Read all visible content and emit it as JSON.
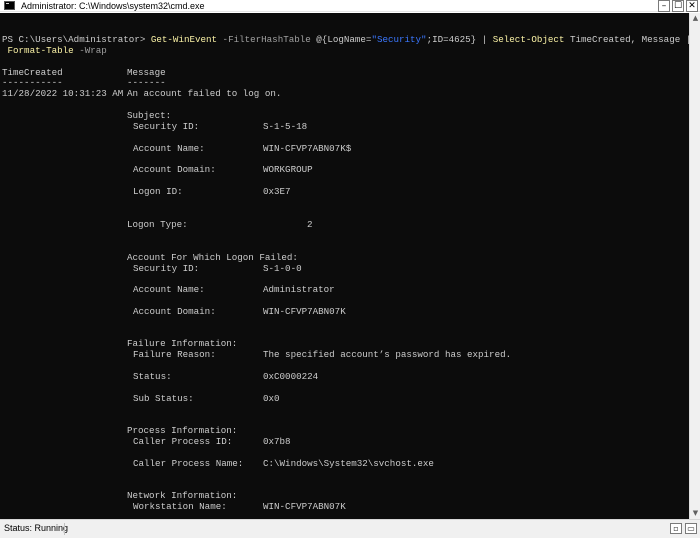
{
  "window": {
    "title": "Administrator: C:\\Windows\\system32\\cmd.exe",
    "controls": {
      "minimize": "–",
      "maximize": "☐",
      "close": "✕"
    }
  },
  "console": {
    "command": {
      "prompt": "PS C:\\Users\\Administrator> ",
      "cmdlet1": "Get-WinEvent",
      "param1": " -FilterHashTable ",
      "hash_open": "@{LogName=",
      "hash_str": "\"Security\"",
      "hash_close": ";ID=4625} | ",
      "cmdlet2": "Select-Object",
      "select_args": " TimeCreated, Message |",
      "cmdlet3": " Format-Table",
      "param3": " -Wrap"
    },
    "headers": {
      "col1": "TimeCreated",
      "col2": "Message",
      "dash1": "-----------",
      "dash2": "-------"
    },
    "time_created": "11/28/2022 10:31:23 AM",
    "message_first": "An account failed to log on.",
    "subject": {
      "heading": "Subject:",
      "security_id": {
        "label": "Security ID:",
        "value": "S-1-5-18"
      },
      "account_name": {
        "label": "Account Name:",
        "value": "WIN-CFVP7ABN07K$"
      },
      "account_domain": {
        "label": "Account Domain:",
        "value": "WORKGROUP"
      },
      "logon_id": {
        "label": "Logon ID:",
        "value": "0x3E7"
      }
    },
    "logon_type": {
      "label": "Logon Type:",
      "value": "2"
    },
    "failed_account": {
      "heading": "Account For Which Logon Failed:",
      "security_id": {
        "label": "Security ID:",
        "value": "S-1-0-0"
      },
      "account_name": {
        "label": "Account Name:",
        "value": "Administrator"
      },
      "account_domain": {
        "label": "Account Domain:",
        "value": "WIN-CFVP7ABN07K"
      }
    },
    "failure": {
      "heading": "Failure Information:",
      "reason": {
        "label": "Failure Reason:",
        "value": "The specified account’s password has expired."
      },
      "status": {
        "label": "Status:",
        "value": "0xC0000224"
      },
      "sub_status": {
        "label": "Sub Status:",
        "value": "0x0"
      }
    },
    "process": {
      "heading": "Process Information:",
      "caller_id": {
        "label": "Caller Process ID:",
        "value": "0x7b8"
      },
      "caller_name": {
        "label": "Caller Process Name:",
        "value": "C:\\Windows\\System32\\svchost.exe"
      }
    },
    "network": {
      "heading": "Network Information:",
      "workstation": {
        "label": "Workstation Name:",
        "value": "WIN-CFVP7ABN07K"
      }
    }
  },
  "colors": {
    "console_bg": "#0c0c0c",
    "console_text": "#cccccc",
    "cmdlet": "#f9f1a5",
    "parameter": "#a0a0a0",
    "string": "#3b78ff"
  },
  "statusbar": {
    "status": "Status: Running"
  }
}
